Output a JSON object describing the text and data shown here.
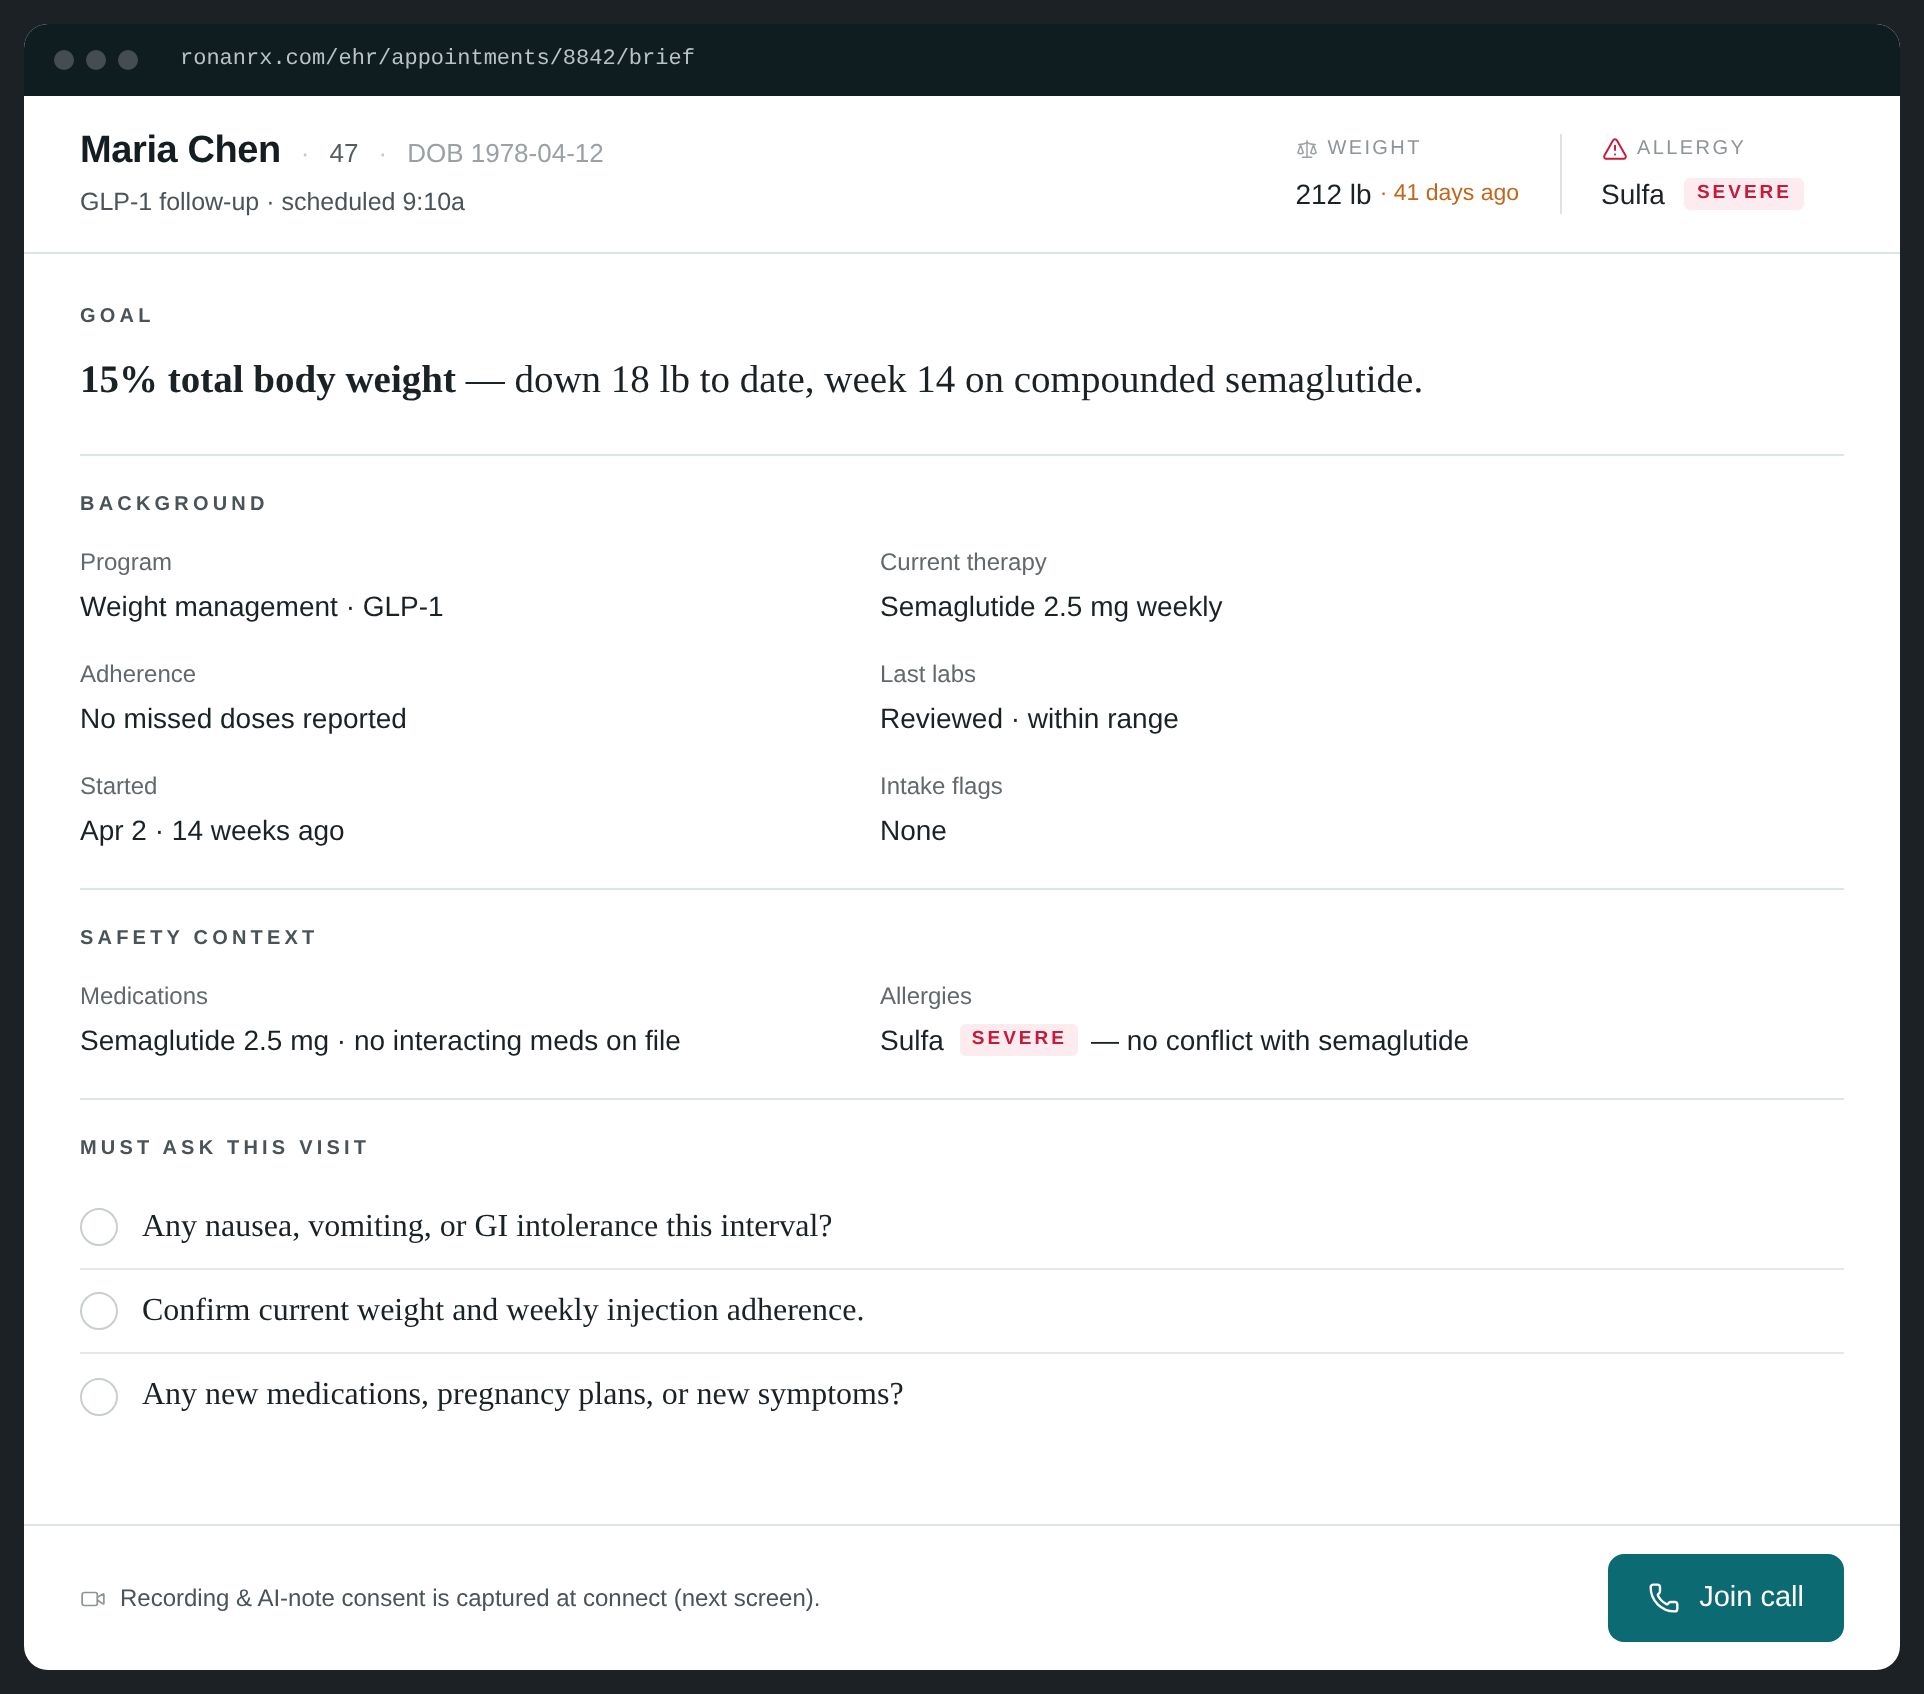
{
  "browser": {
    "url": "ronanrx.com/ehr/appointments/8842/brief"
  },
  "patient": {
    "name": "Maria Chen",
    "details": [
      {
        "kind": "age",
        "separator": "·",
        "text": "47"
      },
      {
        "kind": "dob",
        "separator": "·",
        "text": "DOB 1978-04-12"
      }
    ],
    "visit": "GLP-1 follow-up · scheduled 9:10a"
  },
  "vitals": [
    {
      "kind": "weight",
      "label": "WEIGHT",
      "value": "212 lb",
      "note": "· 41 days ago"
    },
    {
      "kind": "allergy",
      "label": "ALLERGY",
      "value": "Sulfa",
      "badge": "SEVERE"
    }
  ],
  "goal": {
    "label": "GOAL",
    "text": "**15% total body weight** — down 18 lb to date, week 14 on compounded semaglutide."
  },
  "sections": [
    {
      "label": "BACKGROUND",
      "fields": [
        {
          "label": "Program",
          "value": "Weight management · GLP-1"
        },
        {
          "label": "Current therapy",
          "value": "Semaglutide 2.5 mg weekly"
        },
        {
          "label": "Adherence",
          "value": "No missed doses reported"
        },
        {
          "label": "Last labs",
          "value": "Reviewed · within range"
        },
        {
          "label": "Started",
          "value": "Apr 2 · 14 weeks ago"
        },
        {
          "label": "Intake flags",
          "value": "None"
        }
      ]
    },
    {
      "label": "SAFETY CONTEXT",
      "fields": [
        {
          "label": "Medications",
          "value": "Semaglutide 2.5 mg · no interacting meds on file"
        },
        {
          "label": "Allergies",
          "value": "Sulfa",
          "badge": "SEVERE",
          "note": "— no conflict with semaglutide"
        }
      ]
    }
  ],
  "checklist": {
    "label": "MUST ASK THIS VISIT",
    "items": [
      {
        "text": "Any nausea, vomiting, or GI intolerance this interval?",
        "checked": false
      },
      {
        "text": "Confirm current weight and weekly injection adherence.",
        "checked": false
      },
      {
        "text": "Any new medications, pregnancy plans, or new symptoms?",
        "checked": false
      }
    ]
  },
  "footer": {
    "note": "Recording & AI-note consent is captured at connect (next screen).",
    "button": "Join call"
  }
}
